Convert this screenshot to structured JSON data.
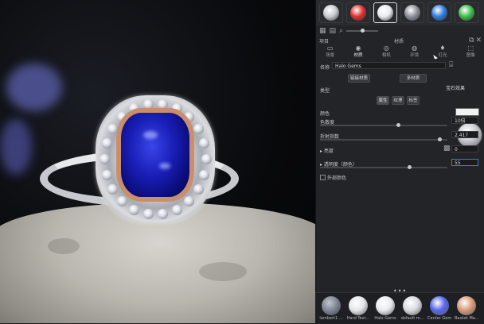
{
  "swatches": [
    {
      "icon": "material-swatch-silver-icon",
      "color": "#c9cbd0"
    },
    {
      "icon": "material-swatch-red-icon",
      "color": "#e0322f"
    },
    {
      "icon": "material-swatch-pearl-icon",
      "color": "#e9edf2"
    },
    {
      "icon": "material-swatch-chrome-icon",
      "color": "#8e939c"
    },
    {
      "icon": "material-swatch-blue-icon",
      "color": "#2f7de0"
    },
    {
      "icon": "material-swatch-green-icon",
      "color": "#3fc04a"
    }
  ],
  "header": {
    "left": "项目",
    "center": "材质"
  },
  "tabs": [
    {
      "label": "场景",
      "icon": "scene-icon"
    },
    {
      "label": "材质",
      "icon": "material-icon"
    },
    {
      "label": "相机",
      "icon": "camera-icon"
    },
    {
      "label": "环境",
      "icon": "environment-icon"
    },
    {
      "label": "灯光",
      "icon": "light-icon"
    },
    {
      "label": "图像",
      "icon": "image-icon"
    }
  ],
  "properties": {
    "name_label": "名称",
    "name_value": "Halo Gems",
    "link_btn": "链接材质",
    "multi_btn": "多材质",
    "type_label": "类型",
    "type_value": "宝石效果",
    "sub_tabs": [
      "属性",
      "纹理",
      "标签"
    ],
    "color_label": "颜色",
    "color_value": "#f2f2f2",
    "abbe_label": "色散度",
    "abbe_value": "10倍",
    "ior_label": "折射指数",
    "ior_value": "2.417",
    "brightness_label": "亮度",
    "brightness_value": "0",
    "transmit_label": "透明度（颜色）",
    "transmit_value": "55",
    "extra_checkbox": "外部颜色"
  },
  "library": [
    {
      "label": "lambert1 ...",
      "color": "#9aa0ae"
    },
    {
      "label": "Hard Text...",
      "color": "#e4e6ea"
    },
    {
      "label": "Halo Gems",
      "color": "#e8eaee"
    },
    {
      "label": "default m...",
      "color": "#d9dbe0"
    },
    {
      "label": "Center Gem",
      "color": "#5a66e8"
    },
    {
      "label": "Basket Ma...",
      "color": "#d79a78"
    }
  ]
}
